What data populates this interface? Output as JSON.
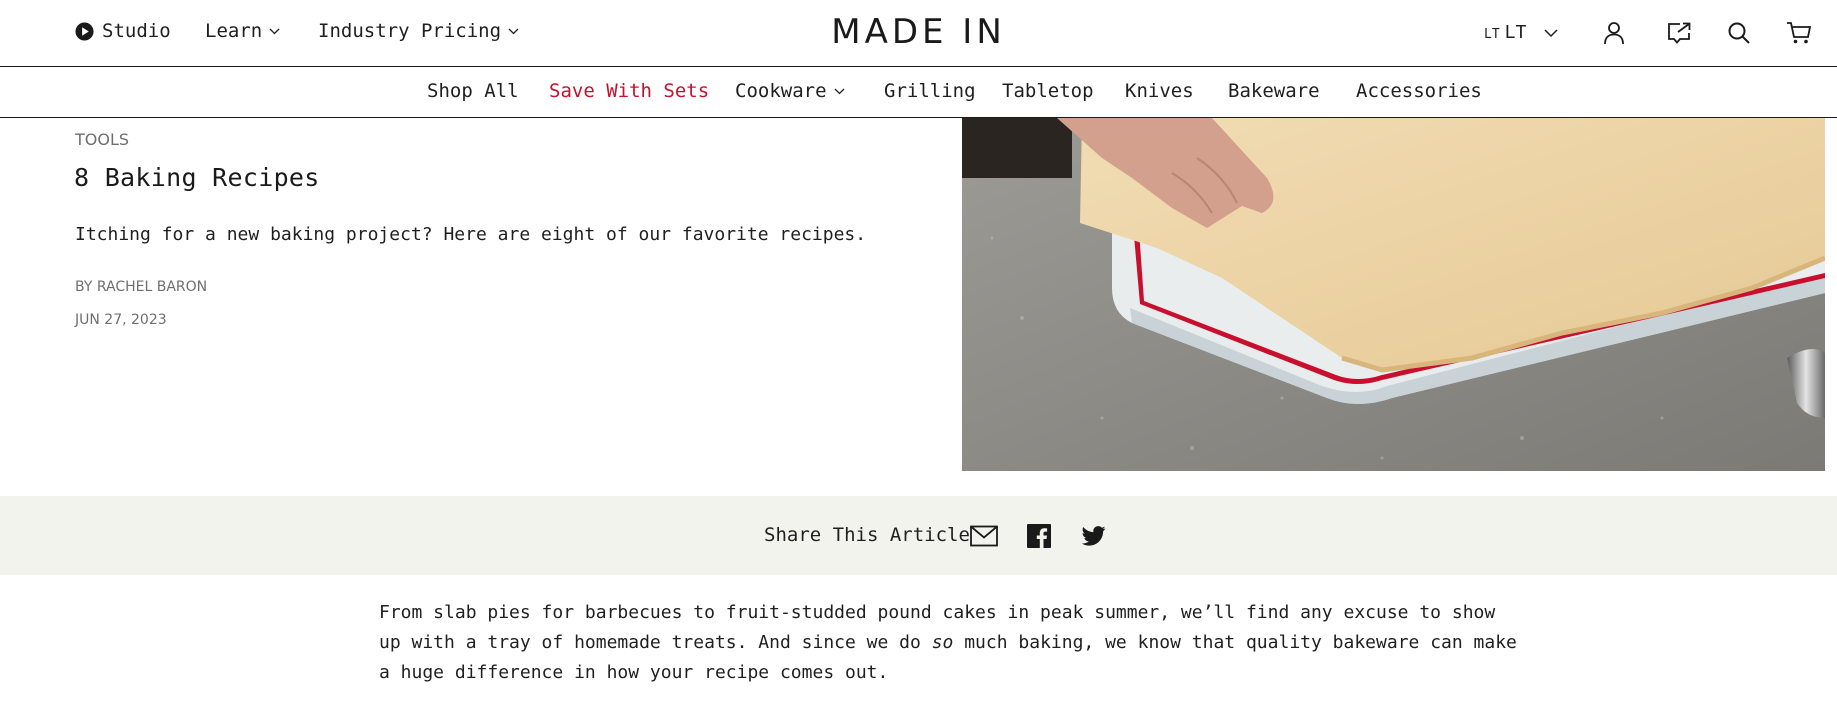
{
  "header": {
    "studio_label": "Studio",
    "learn_label": "Learn",
    "industry_label": "Industry Pricing",
    "brand": "MADE IN",
    "lang_small": "LT",
    "lang_label": "LT",
    "icons": [
      "play-icon",
      "chevron-down-icon",
      "user-icon",
      "share-out-icon",
      "search-icon",
      "cart-icon"
    ]
  },
  "nav": {
    "items": [
      {
        "label": "Shop All"
      },
      {
        "label": "Save With Sets"
      },
      {
        "label": "Cookware"
      },
      {
        "label": "Grilling"
      },
      {
        "label": "Tabletop"
      },
      {
        "label": "Knives"
      },
      {
        "label": "Bakeware"
      },
      {
        "label": "Accessories"
      }
    ],
    "highlight_color": "#c8102e"
  },
  "article": {
    "category": "TOOLS",
    "title": "8 Baking Recipes",
    "dek": "Itching for a new baking project? Here are eight of our favorite recipes.",
    "byline": "BY RACHEL BARON",
    "date": "JUN 27, 2023",
    "body_before": "From slab pies for barbecues to fruit-studded pound cakes in peak summer, we’ll find any excuse to show up with a tray of homemade treats. And since we do ",
    "body_emphasis": "so",
    "body_after": " much baking, we know that quality bakeware can make a huge difference in how your recipe comes out."
  },
  "share": {
    "label": "Share This Article",
    "icons": [
      "email-icon",
      "facebook-icon",
      "twitter-icon"
    ]
  }
}
